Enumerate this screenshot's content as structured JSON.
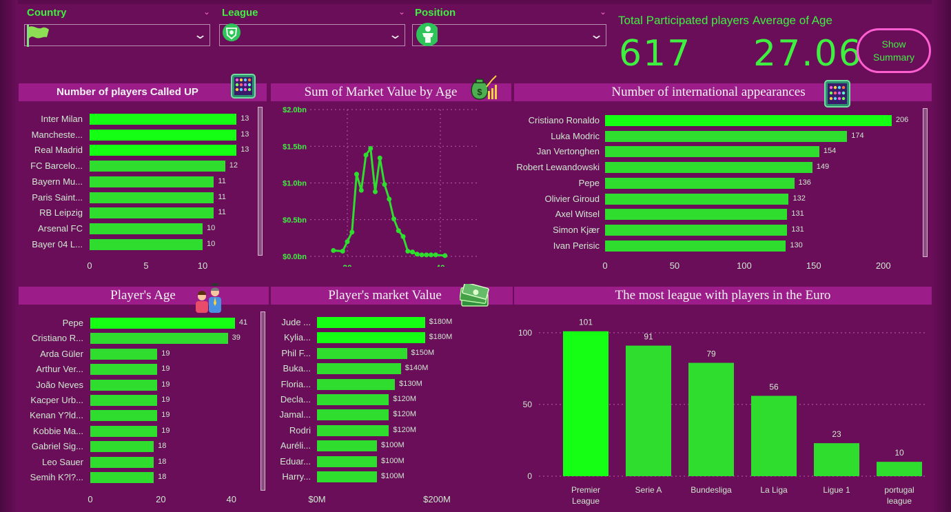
{
  "colors": {
    "background": "#6a0e5a",
    "header": "#9c1c8a",
    "bar": "#2fdd2f",
    "bar_top": "#14ff14",
    "accent": "#3ff040",
    "button_border": "#ff5fd0"
  },
  "slicers": [
    {
      "title": "Country",
      "icon": "flag-icon"
    },
    {
      "title": "League",
      "icon": "league-badge-icon"
    },
    {
      "title": "Position",
      "icon": "player-position-icon"
    }
  ],
  "kpis": {
    "total_label": "Total Participated players",
    "total_value": "617",
    "age_label": "Average of Age",
    "age_value": "27.06"
  },
  "summary_button": {
    "line1": "Show",
    "line2": "Summary"
  },
  "panels": {
    "called_up": "Number of players Called UP",
    "market_by_age": "Sum of Market Value by Age",
    "appearances": "Number of international appearances",
    "player_age": "Player's Age",
    "market_value": "Player's market Value",
    "league": "The most league with players in the Euro"
  },
  "chart_data": [
    {
      "id": "called_up",
      "type": "bar",
      "orientation": "horizontal",
      "title": "Number of players Called UP",
      "categories": [
        "Inter Milan",
        "Manchester City",
        "Real Madrid",
        "FC Barcelona",
        "Bayern Munich",
        "Paris Saint-Germain",
        "RB Leipzig",
        "Arsenal FC",
        "Bayer 04 Leverkusen"
      ],
      "display_labels": [
        "Inter Milan",
        "Mancheste...",
        "Real Madrid",
        "FC Barcelo...",
        "Bayern Mu...",
        "Paris Saint...",
        "RB Leipzig",
        "Arsenal FC",
        "Bayer 04 L..."
      ],
      "values": [
        13,
        13,
        13,
        12,
        11,
        11,
        11,
        10,
        10
      ],
      "xticks": [
        "0",
        "5",
        "10"
      ],
      "xlim": [
        0,
        15
      ]
    },
    {
      "id": "market_by_age",
      "type": "line",
      "title": "Sum of Market Value by Age",
      "x": [
        17,
        19,
        20,
        21,
        22,
        23,
        24,
        25,
        26,
        27,
        28,
        29,
        30,
        31,
        32,
        33,
        34,
        35,
        36,
        37,
        38,
        39,
        41
      ],
      "values": [
        0.08,
        0.07,
        0.2,
        0.33,
        1.12,
        0.9,
        1.38,
        1.47,
        0.88,
        1.34,
        0.98,
        0.78,
        0.51,
        0.35,
        0.27,
        0.07,
        0.06,
        0.03,
        0.02,
        0.02,
        0.02,
        0.02,
        0.01
      ],
      "yticks": [
        "$0.0bn",
        "$0.5bn",
        "$1.0bn",
        "$1.5bn",
        "$2.0bn"
      ],
      "xticks": [
        "20",
        "40"
      ],
      "ylim": [
        0,
        2.0
      ],
      "xlim": [
        12,
        48
      ],
      "grid": true
    },
    {
      "id": "appearances",
      "type": "bar",
      "orientation": "horizontal",
      "title": "Number of international appearances",
      "categories": [
        "Cristiano Ronaldo",
        "Luka Modric",
        "Jan Vertonghen",
        "Robert Lewandowski",
        "Pepe",
        "Olivier Giroud",
        "Axel Witsel",
        "Simon Kjær",
        "Ivan Perisic"
      ],
      "values": [
        206,
        174,
        154,
        149,
        136,
        132,
        131,
        131,
        130
      ],
      "xticks": [
        "0",
        "50",
        "100",
        "150",
        "200"
      ],
      "xlim": [
        0,
        215
      ]
    },
    {
      "id": "player_age",
      "type": "bar",
      "orientation": "horizontal",
      "title": "Player's Age",
      "categories": [
        "Pepe",
        "Cristiano Ronaldo",
        "Arda Güler",
        "Arthur Vermeeren",
        "João Neves",
        "Kacper Urbański",
        "Kenan Yıldız",
        "Kobbie Mainoo",
        "Gabriel Sigua",
        "Leo Sauer",
        "Semih Kılıçsoy"
      ],
      "display_labels": [
        "Pepe",
        "Cristiano R...",
        "Arda Güler",
        "Arthur Ver...",
        "João Neves",
        "Kacper Urb...",
        "Kenan Y?ld...",
        "Kobbie Ma...",
        "Gabriel Sig...",
        "Leo Sauer",
        "Semih K?l?..."
      ],
      "values": [
        41,
        39,
        19,
        19,
        19,
        19,
        19,
        19,
        18,
        18,
        18
      ],
      "xticks": [
        "0",
        "20",
        "40"
      ],
      "xlim": [
        0,
        42
      ]
    },
    {
      "id": "market_value",
      "type": "bar",
      "orientation": "horizontal",
      "title": "Player's market Value",
      "categories": [
        "Jude Bellingham",
        "Kylian Mbappé",
        "Phil Foden",
        "Bukayo Saka",
        "Florian Wirtz",
        "Declan Rice",
        "Jamal Musiala",
        "Rodri",
        "Aurélien Tchouaméni",
        "Eduardo Camavinga",
        "Harry Kane"
      ],
      "display_labels": [
        "Jude ...",
        "Kylia...",
        "Phil F...",
        "Buka...",
        "Floria...",
        "Decla...",
        "Jamal...",
        "Rodri",
        "Auréli...",
        "Eduar...",
        "Harry..."
      ],
      "values": [
        180,
        180,
        150,
        140,
        130,
        120,
        120,
        120,
        100,
        100,
        100
      ],
      "value_labels": [
        "$180M",
        "$180M",
        "$150M",
        "$140M",
        "$130M",
        "$120M",
        "$120M",
        "$120M",
        "$100M",
        "$100M",
        "$100M"
      ],
      "xticks": [
        "$0M",
        "$200M"
      ],
      "xlim": [
        0,
        200
      ]
    },
    {
      "id": "league",
      "type": "bar",
      "orientation": "vertical",
      "title": "The most league with players in the Euro",
      "categories": [
        "Premier League",
        "Serie A",
        "Bundesliga",
        "La Liga",
        "Ligue 1",
        "portugal league"
      ],
      "category_lines": [
        [
          "Premier",
          "League"
        ],
        [
          "Serie A"
        ],
        [
          "Bundesliga"
        ],
        [
          "La Liga"
        ],
        [
          "Ligue 1"
        ],
        [
          "portugal",
          "league"
        ]
      ],
      "values": [
        101,
        91,
        79,
        56,
        23,
        10
      ],
      "yticks": [
        "0",
        "50",
        "100"
      ],
      "ylim": [
        0,
        110
      ],
      "grid": true
    }
  ]
}
